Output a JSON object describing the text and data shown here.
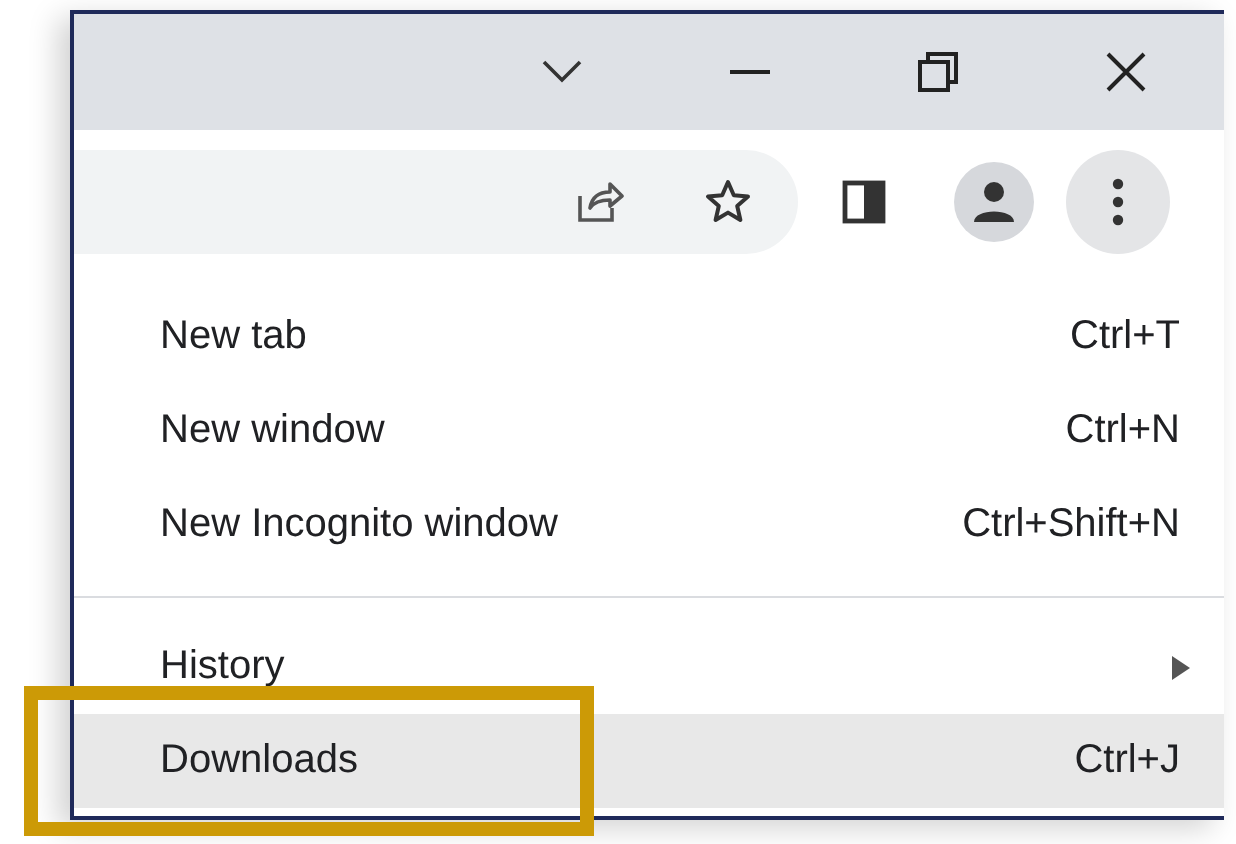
{
  "menu": {
    "sections": [
      [
        {
          "label": "New tab",
          "shortcut": "Ctrl+T",
          "submenu": false,
          "selected": false
        },
        {
          "label": "New window",
          "shortcut": "Ctrl+N",
          "submenu": false,
          "selected": false
        },
        {
          "label": "New Incognito window",
          "shortcut": "Ctrl+Shift+N",
          "submenu": false,
          "selected": false
        }
      ],
      [
        {
          "label": "History",
          "submenu": true,
          "selected": false
        },
        {
          "label": "Downloads",
          "shortcut": "Ctrl+J",
          "submenu": false,
          "selected": true
        }
      ]
    ]
  }
}
